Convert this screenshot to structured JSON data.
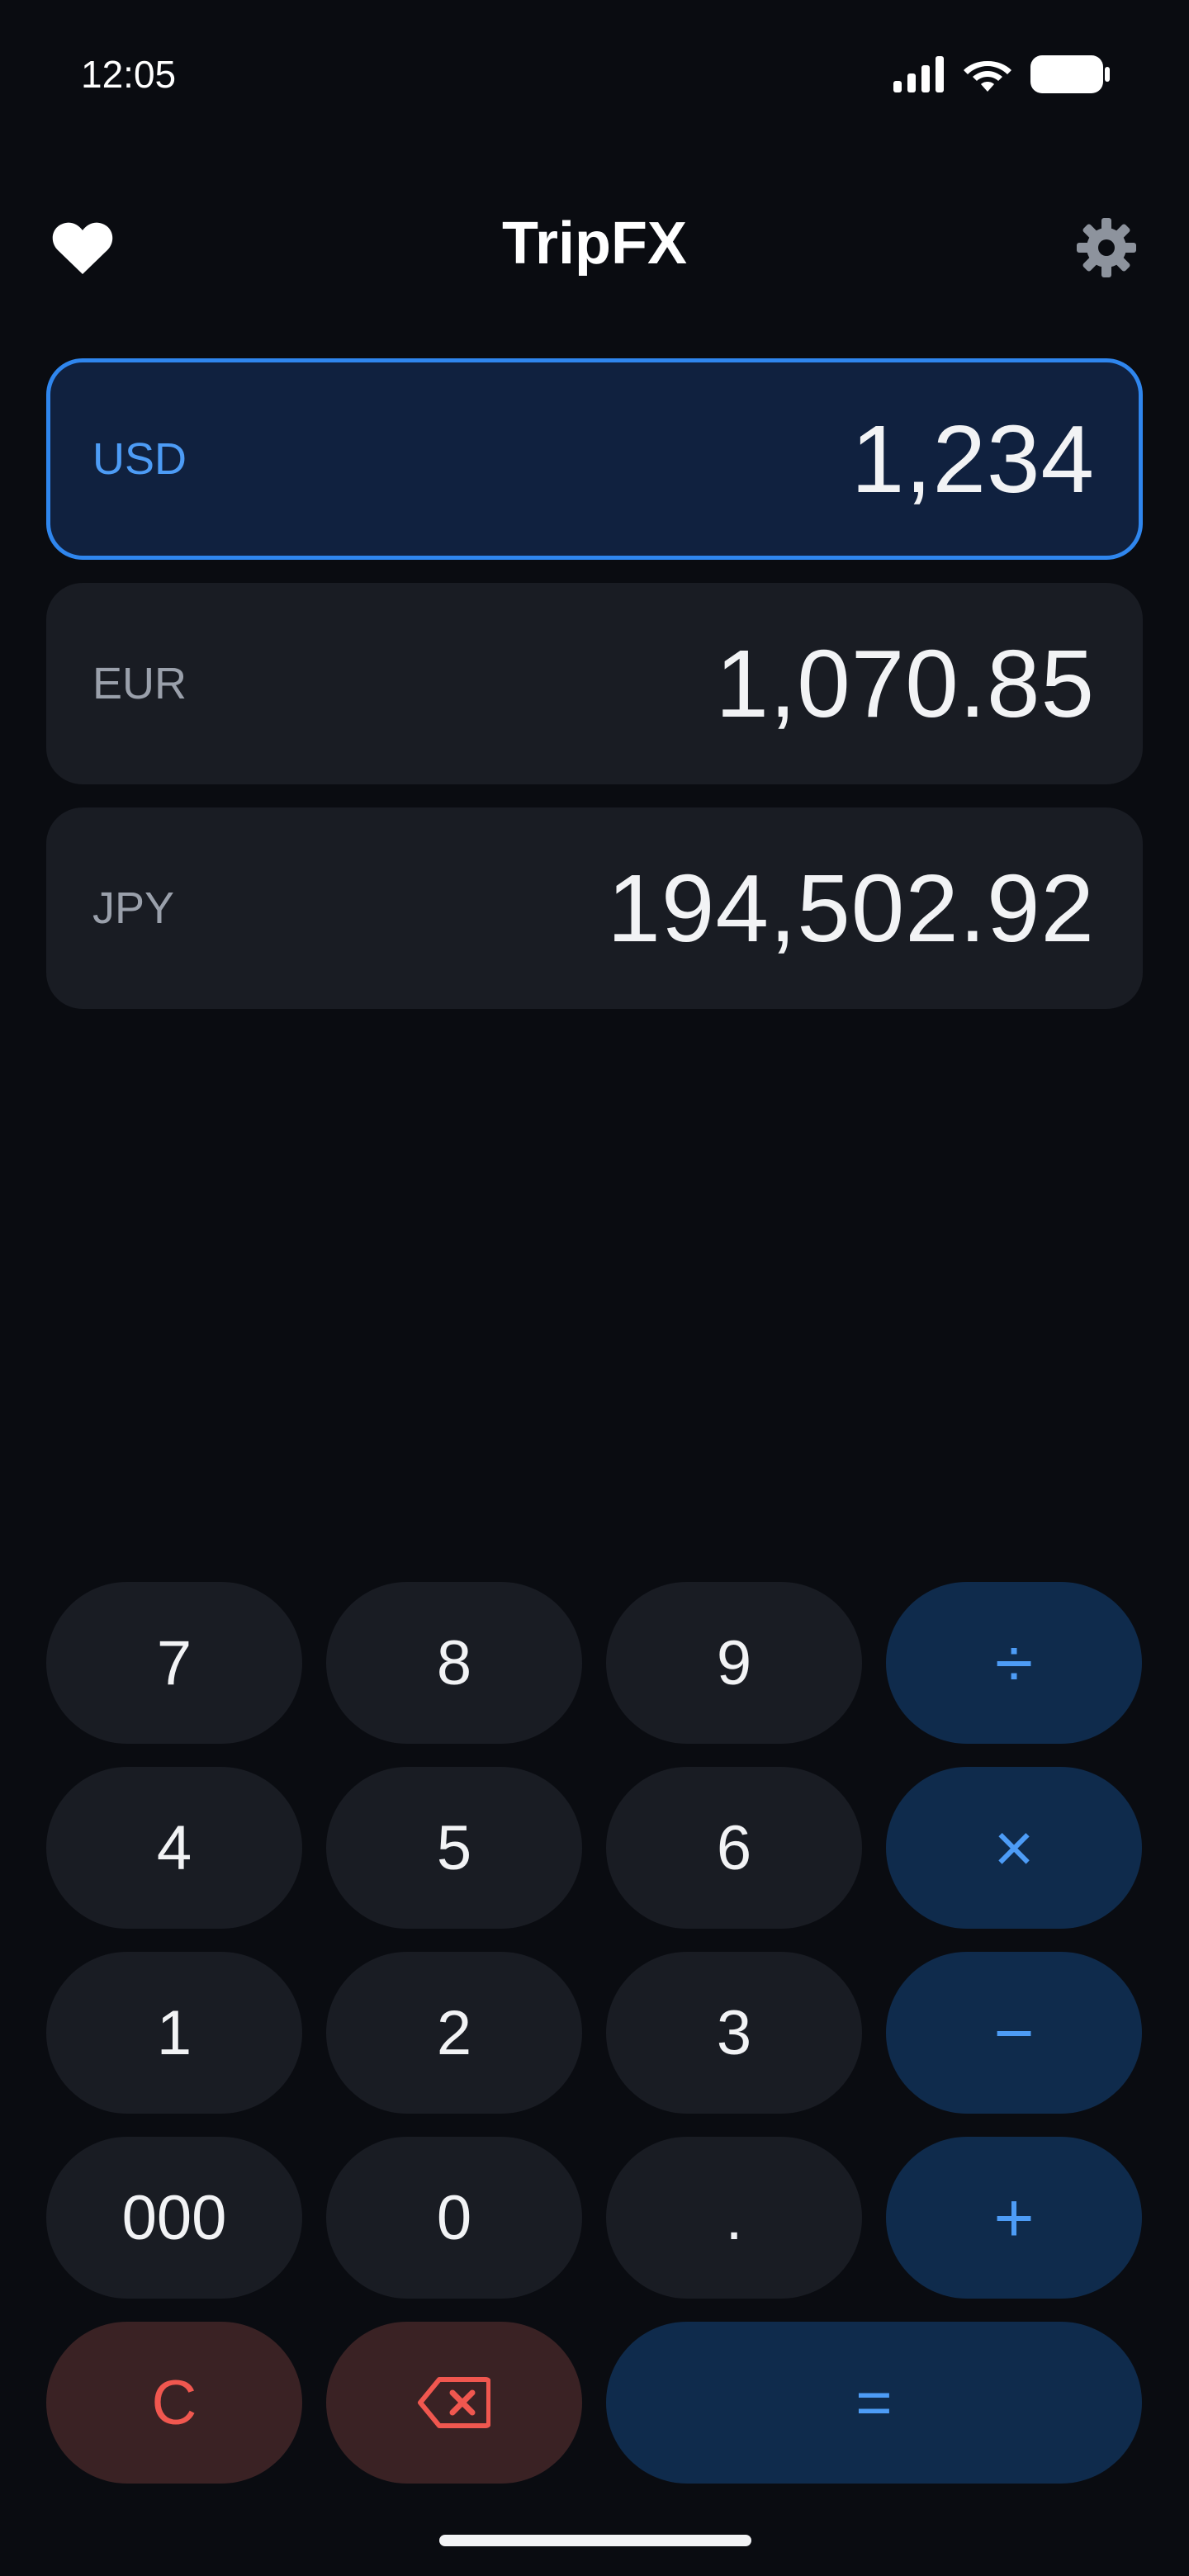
{
  "status_bar": {
    "time": "12:05"
  },
  "header": {
    "title": "TripFX"
  },
  "currencies": [
    {
      "code": "USD",
      "value": "1,234",
      "active": true
    },
    {
      "code": "EUR",
      "value": "1,070.85",
      "active": false
    },
    {
      "code": "JPY",
      "value": "194,502.92",
      "active": false
    }
  ],
  "keypad": {
    "k7": "7",
    "k8": "8",
    "k9": "9",
    "divide": "÷",
    "k4": "4",
    "k5": "5",
    "k6": "6",
    "multiply": "×",
    "k1": "1",
    "k2": "2",
    "k3": "3",
    "minus": "−",
    "k000": "000",
    "k0": "0",
    "dot": ".",
    "plus": "+",
    "clear": "C",
    "equals": "="
  },
  "colors": {
    "background": "#0a0c11",
    "card": "#191c23",
    "active_card": "#10213f",
    "accent": "#4d9cf6",
    "accent_border": "#2f86ee",
    "operator_key": "#0f2b4c",
    "danger_key": "#3a2224",
    "danger_text": "#f0574f"
  },
  "icons": {
    "favorite": "heart-icon",
    "settings": "gear-icon",
    "backspace": "backspace-icon",
    "signal": "signal-icon",
    "wifi": "wifi-icon",
    "battery": "battery-icon"
  }
}
